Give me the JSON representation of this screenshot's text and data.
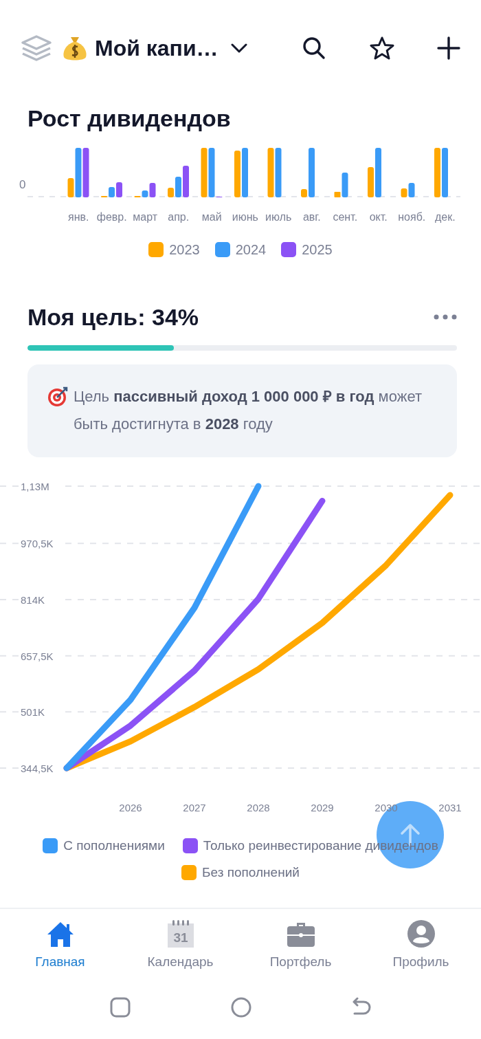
{
  "header": {
    "title": "Мой капи…"
  },
  "dividend_growth": {
    "title": "Рост дивидендов",
    "y_label": "0",
    "months": [
      "янв.",
      "февр.",
      "март",
      "апр.",
      "май",
      "июнь",
      "июль",
      "авг.",
      "сент.",
      "окт.",
      "нояб.",
      "дек."
    ],
    "legend": [
      {
        "label": "2023",
        "color": "#ffa800"
      },
      {
        "label": "2024",
        "color": "#3a9bf7"
      },
      {
        "label": "2025",
        "color": "#8b52f5"
      }
    ]
  },
  "goal": {
    "title": "Моя цель: 34%",
    "level": 0.34,
    "message": "Цель **пассивный доход 1 000 000 ₽ в год** может быть достигнута в **2028** году"
  },
  "projection": {
    "chart_data": {
      "type": "line",
      "grid": true,
      "x": [
        2025,
        2026,
        2027,
        2028,
        2029,
        2030,
        2031
      ],
      "xticks": [
        2026,
        2027,
        2028,
        2029,
        2030,
        2031
      ],
      "xlim": [
        2025,
        2031
      ],
      "ylim": [
        344500,
        1130000
      ],
      "yticks": [
        {
          "value": 344500,
          "label": "344,5K"
        },
        {
          "value": 501000,
          "label": "501K"
        },
        {
          "value": 657500,
          "label": "657,5K"
        },
        {
          "value": 814000,
          "label": "814K"
        },
        {
          "value": 970500,
          "label": "970,5K"
        },
        {
          "value": 1130000,
          "label": "1,13M"
        }
      ],
      "series": [
        {
          "name": "С пополнениями",
          "color": "#3a9bf7",
          "values": [
            344500,
            535000,
            791000,
            1130000,
            null,
            null,
            null
          ]
        },
        {
          "name": "Только реинвестирование дивидендов",
          "color": "#8b52f5",
          "values": [
            344500,
            463000,
            616000,
            816000,
            1089000,
            null,
            null
          ]
        },
        {
          "name": "Без пополнений",
          "color": "#ffa800",
          "values": [
            344500,
            419000,
            514500,
            619500,
            749000,
            910000,
            1105000
          ]
        }
      ]
    }
  },
  "bottom_nav": [
    {
      "label": "Главная",
      "kind": "home",
      "selected": true
    },
    {
      "label": "Календарь",
      "kind": "calendar",
      "icon_text": "31",
      "selected": false
    },
    {
      "label": "Портфель",
      "kind": "briefcase",
      "selected": false
    },
    {
      "label": "Профиль",
      "kind": "person",
      "selected": false
    }
  ]
}
